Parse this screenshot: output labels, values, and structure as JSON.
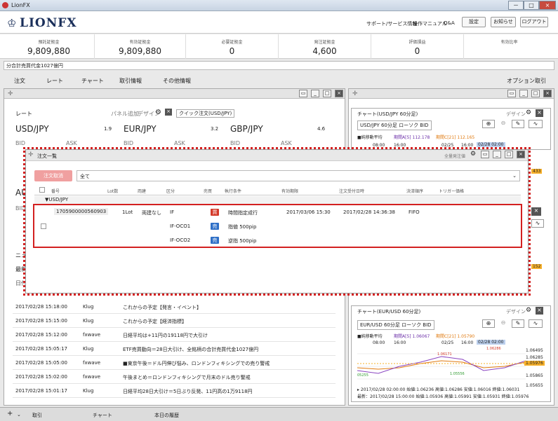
{
  "window": {
    "title": "LionFX",
    "min": "－",
    "max": "□",
    "close": "×"
  },
  "header": {
    "logo": "LIONFX",
    "links": [
      "サポート/サービス情報",
      "操作マニュアル",
      "Q&A"
    ],
    "buttons": [
      "設定",
      "お知らせ",
      "ログアウト"
    ]
  },
  "stats": [
    {
      "label": "預託証拠金",
      "value": "9,809,880"
    },
    {
      "label": "有効証拠金",
      "value": "9,809,880"
    },
    {
      "label": "必要証拠金",
      "value": "0"
    },
    {
      "label": "発注証拠金",
      "value": "4,600"
    },
    {
      "label": "評価損益",
      "value": "0"
    },
    {
      "label": "有効比率",
      "value": ""
    }
  ],
  "notice": "分合計売買代金1027億円",
  "menu": {
    "items": [
      "注文",
      "レート",
      "チャート",
      "取引情報",
      "その他情報"
    ],
    "option": "オプション取引"
  },
  "rate_panel": {
    "title": "レート",
    "tools": [
      "パネル追加",
      "デザイン"
    ],
    "quick": "クイック注文(USD/JPY)",
    "pairs": [
      {
        "name": "USD/JPY",
        "spread": "1.9"
      },
      {
        "name": "EUR/JPY",
        "spread": "3.2"
      },
      {
        "name": "GBP/JPY",
        "spread": "4.6"
      }
    ],
    "bid": "BID",
    "ask": "ASK",
    "au": "AU",
    "bid2": "BID",
    "news": "ニュ",
    "news2": "最新",
    "date": "日付"
  },
  "news": [
    {
      "time": "2017/02/28 15:18:00",
      "src": "Klug",
      "title": "これからの予定【発言・イベント】"
    },
    {
      "time": "2017/02/28 15:15:00",
      "src": "Klug",
      "title": "これからの予定【経済指標】"
    },
    {
      "time": "2017/02/28 15:12:00",
      "src": "fxwave",
      "title": "日経平均は+11円の19118円で大引け"
    },
    {
      "time": "2017/02/28 15:05:17",
      "src": "Klug",
      "title": "ETF売買動向＝28日大引け、全銘柄の合計売買代金1027億円"
    },
    {
      "time": "2017/02/28 15:05:00",
      "src": "fxwave",
      "title": "■東京午後＝ドル円伸び悩み、ロンドンフィキシングでの売り警戒"
    },
    {
      "time": "2017/02/28 15:02:00",
      "src": "fxwave",
      "title": "午後まとめ＝ロンドンフィキシングで月末のドル売り警戒"
    },
    {
      "time": "2017/02/28 15:01:17",
      "src": "Klug",
      "title": "日経平均28日大引け＝5日ぶり反発、11円高の1万9118円"
    }
  ],
  "chart1": {
    "title": "チャート(USD/JPY 60分足)",
    "design": "デザイン",
    "label": "USD/JPY 60分足 ローソク BID",
    "legend": [
      "■純移動平均",
      "期間A[5] 112.178",
      "期間C[21] 112.165"
    ],
    "times": [
      "08:00",
      "16:00",
      "02/25",
      "16:00",
      "02/28 02:00"
    ],
    "side": [
      "433",
      "152"
    ]
  },
  "chart2": {
    "title": "チャート(EUR/USD 60分足)",
    "design": "デザイン",
    "label": "EUR/USD 60分足 ローソク BID",
    "legend": [
      "■純移動平均",
      "期間A[5] 1.06067",
      "期間C[21] 1.05790"
    ],
    "times": [
      "08:00",
      "16:00",
      "02/25",
      "16:00",
      "02/28 02:00"
    ],
    "prices": [
      "1.06495",
      "1.06285",
      "1.06075",
      "1.05976",
      "1.05865",
      "1.05655"
    ],
    "marks": [
      "1.06171",
      "1.06286",
      "1.05556",
      "05255"
    ],
    "info1": "▸ 2017/02/28 02:00:00 始値:1.06236 高値:1.06286 安値:1.06016 終値:1.06031",
    "info2": "最新：2017/02/28 15:00:00 始値:1.05936 高値:1.05991 安値:1.05931 終値:1.05976"
  },
  "dialog": {
    "title": "注文一覧",
    "setting": "全量発注値",
    "cancel_btn": "注文取消",
    "filter": "全て",
    "columns": [
      "番号",
      "Lot数",
      "両建",
      "区分",
      "売買",
      "執行条件",
      "有効期限",
      "注文受付日時",
      "決済順序",
      "トリガー価格"
    ],
    "group": "▼USD/JPY",
    "rows": [
      {
        "no": "1705900000560903",
        "lot": "1Lot",
        "ryodate": "両建なし",
        "type": "IF",
        "side": "買",
        "cond": "時間指定成行",
        "expire": "2017/03/06 15:30",
        "recv": "2017/02/28 14:36:38",
        "order": "FIFO"
      },
      {
        "no": "",
        "lot": "",
        "ryodate": "",
        "type": "IF-OCO1",
        "side": "売",
        "cond": "指値 500pip",
        "expire": "",
        "recv": "",
        "order": ""
      },
      {
        "no": "",
        "lot": "",
        "ryodate": "",
        "type": "IF-OCO2",
        "side": "売",
        "cond": "逆指 500pip",
        "expire": "",
        "recv": "",
        "order": ""
      }
    ]
  },
  "bottom": {
    "add": "+",
    "tabs": [
      "取引",
      "チャート",
      "本日の履歴"
    ]
  },
  "colors": {
    "buy": "#d43a2a",
    "sell": "#2e6fc7",
    "highlight": "#d32020"
  }
}
